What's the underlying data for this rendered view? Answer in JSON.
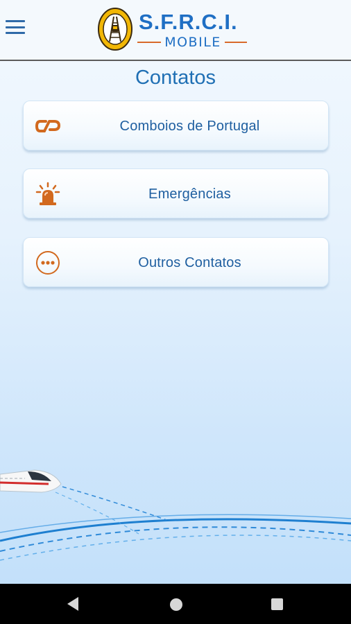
{
  "header": {
    "logo_title": "S.F.R.C.I.",
    "logo_subtitle": "MOBILE"
  },
  "page": {
    "title": "Contatos"
  },
  "contacts": [
    {
      "label": "Comboios de Portugal",
      "icon": "cp-logo-icon"
    },
    {
      "label": "Emergências",
      "icon": "siren-icon"
    },
    {
      "label": "Outros Contatos",
      "icon": "more-dots-icon"
    }
  ],
  "colors": {
    "primary_blue": "#1f6fb4",
    "accent_orange": "#d86a2a",
    "navbar": "#000000"
  },
  "system_nav": {
    "back_icon": "back-triangle-icon",
    "home_icon": "home-circle-icon",
    "recent_icon": "recent-apps-square-icon"
  }
}
